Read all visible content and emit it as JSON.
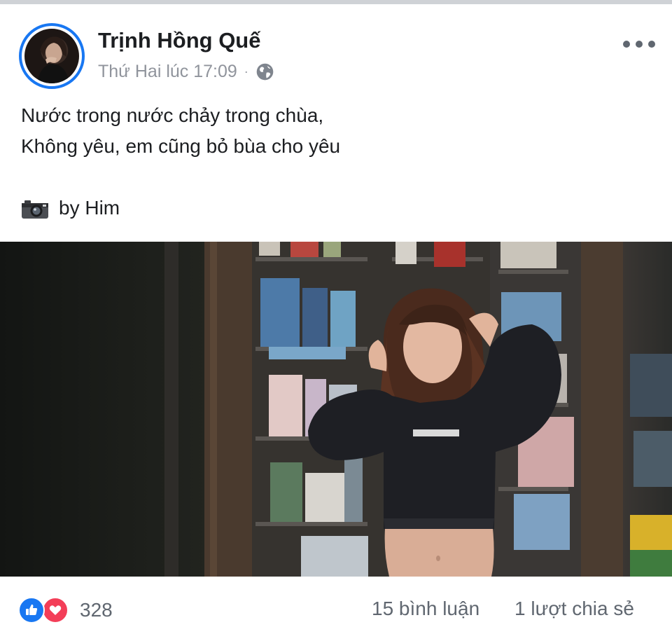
{
  "post": {
    "author": "Trịnh Hồng Quế",
    "timestamp": "Thứ Hai lúc 17:09",
    "separator": "·",
    "audience_icon": "globe-icon",
    "more_icon": "more-options-icon",
    "text_lines": [
      "Nước trong nước chảy trong chùa,",
      "Không yêu, em cũng bỏ bùa cho yêu"
    ],
    "credit_icon": "camera-icon",
    "credit_text": "by Him",
    "photo_icon": "post-photo"
  },
  "footer": {
    "reaction_icons": [
      "like-icon",
      "love-icon"
    ],
    "reaction_count": "328",
    "comments": "15 bình luận",
    "shares": "1 lượt chia sẻ"
  },
  "colors": {
    "brand_blue": "#1877f2",
    "love_red": "#f33e58",
    "meta_gray": "#90949c",
    "text": "#1c1e21"
  }
}
